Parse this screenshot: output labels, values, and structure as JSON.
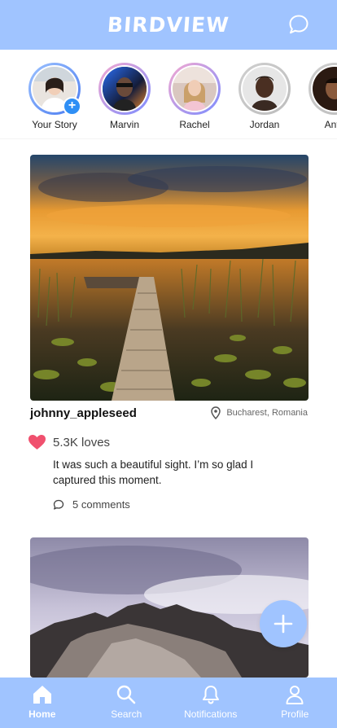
{
  "app": {
    "title": "BIRDVIEW"
  },
  "header": {
    "chat_icon": "chat-bubble-icon"
  },
  "stories": [
    {
      "name": "Your Story",
      "has_add": true,
      "ring": "linear-gradient(135deg,#9cc2ff,#4a7bf0)"
    },
    {
      "name": "Marvin",
      "ring": "linear-gradient(135deg,#f5a9d0,#7b8cff)"
    },
    {
      "name": "Rachel",
      "ring": "linear-gradient(135deg,#f5a9d0,#7b8cff)"
    },
    {
      "name": "Jordan",
      "ring": "linear-gradient(135deg,#cfcfcf,#bdbdbd)"
    },
    {
      "name": "Anto",
      "ring": "linear-gradient(135deg,#cfcfcf,#bdbdbd)"
    }
  ],
  "post": {
    "username": "johnny_appleseed",
    "location": "Bucharest, Romania",
    "loves": "5.3K loves",
    "caption": "It was such a beautiful sight. I’m so glad I captured this moment.",
    "comments": "5 comments"
  },
  "fab": {
    "icon": "plus-icon"
  },
  "tabs": [
    {
      "label": "Home",
      "icon": "home-icon",
      "active": true
    },
    {
      "label": "Search",
      "icon": "search-icon"
    },
    {
      "label": "Notifications",
      "icon": "bell-icon"
    },
    {
      "label": "Profile",
      "icon": "person-icon"
    }
  ],
  "colors": {
    "accent": "#a0c4ff",
    "heart": "#f0506e",
    "badge": "#2f8ff5"
  }
}
